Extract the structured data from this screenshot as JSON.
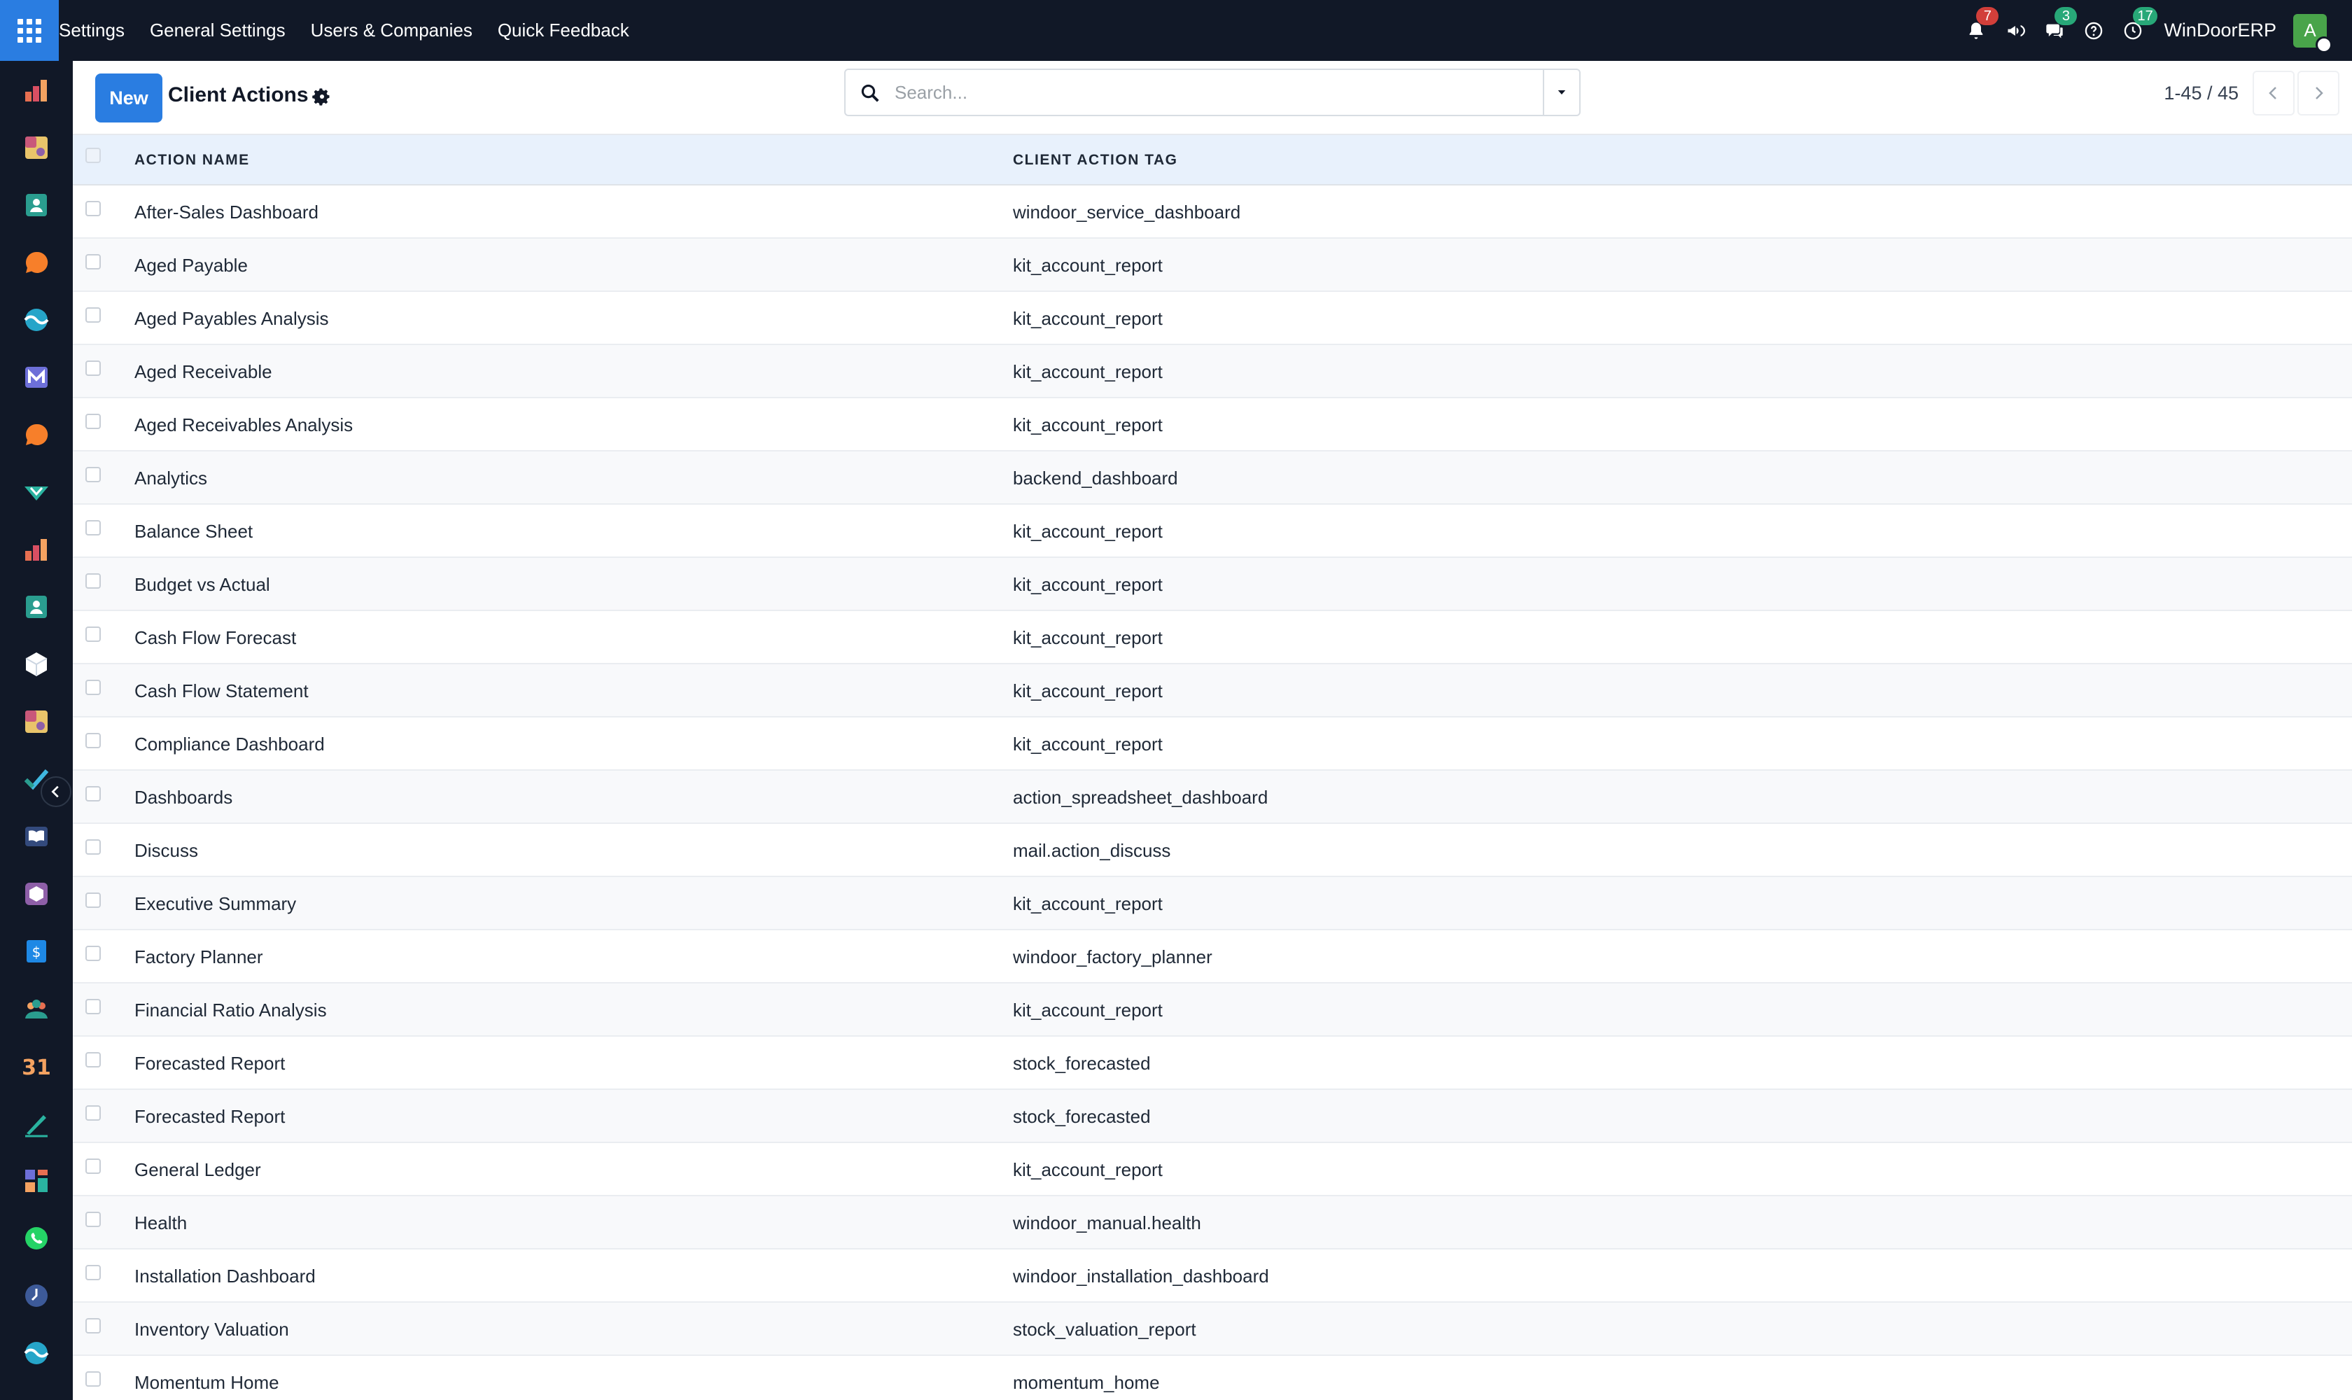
{
  "topbar": {
    "menu": [
      "Settings",
      "General Settings",
      "Users & Companies",
      "Quick Feedback"
    ],
    "badges": {
      "activity": "7",
      "messages": "3",
      "timer": "17"
    },
    "company": "WinDoorERP",
    "avatar_initial": "A",
    "brand_color": "#2a7de1"
  },
  "sidebar": {
    "apps": [
      "chart-bars-icon",
      "puzzle-icon",
      "contacts-icon",
      "chat-bubble-icon",
      "wave-icon",
      "mail-icon",
      "chat-bubble-icon",
      "check-v-icon",
      "chart-bars-icon",
      "contacts-icon",
      "cube-icon",
      "puzzle-icon",
      "check-icon",
      "book-icon",
      "box-icon",
      "dollar-doc-icon",
      "team-icon",
      "calendar-31-icon",
      "pen-icon",
      "dashboard-icon",
      "whatsapp-icon",
      "clock-icon",
      "wave-icon"
    ]
  },
  "control": {
    "new_label": "New",
    "title": "Client Actions",
    "search_placeholder": "Search...",
    "pager": "1-45 / 45"
  },
  "table": {
    "columns": [
      "ACTION NAME",
      "CLIENT ACTION TAG"
    ],
    "rows": [
      [
        "After-Sales Dashboard",
        "windoor_service_dashboard"
      ],
      [
        "Aged Payable",
        "kit_account_report"
      ],
      [
        "Aged Payables Analysis",
        "kit_account_report"
      ],
      [
        "Aged Receivable",
        "kit_account_report"
      ],
      [
        "Aged Receivables Analysis",
        "kit_account_report"
      ],
      [
        "Analytics",
        "backend_dashboard"
      ],
      [
        "Balance Sheet",
        "kit_account_report"
      ],
      [
        "Budget vs Actual",
        "kit_account_report"
      ],
      [
        "Cash Flow Forecast",
        "kit_account_report"
      ],
      [
        "Cash Flow Statement",
        "kit_account_report"
      ],
      [
        "Compliance Dashboard",
        "kit_account_report"
      ],
      [
        "Dashboards",
        "action_spreadsheet_dashboard"
      ],
      [
        "Discuss",
        "mail.action_discuss"
      ],
      [
        "Executive Summary",
        "kit_account_report"
      ],
      [
        "Factory Planner",
        "windoor_factory_planner"
      ],
      [
        "Financial Ratio Analysis",
        "kit_account_report"
      ],
      [
        "Forecasted Report",
        "stock_forecasted"
      ],
      [
        "Forecasted Report",
        "stock_forecasted"
      ],
      [
        "General Ledger",
        "kit_account_report"
      ],
      [
        "Health",
        "windoor_manual.health"
      ],
      [
        "Installation Dashboard",
        "windoor_installation_dashboard"
      ],
      [
        "Inventory Valuation",
        "stock_valuation_report"
      ],
      [
        "Momentum Home",
        "momentum_home"
      ]
    ]
  }
}
